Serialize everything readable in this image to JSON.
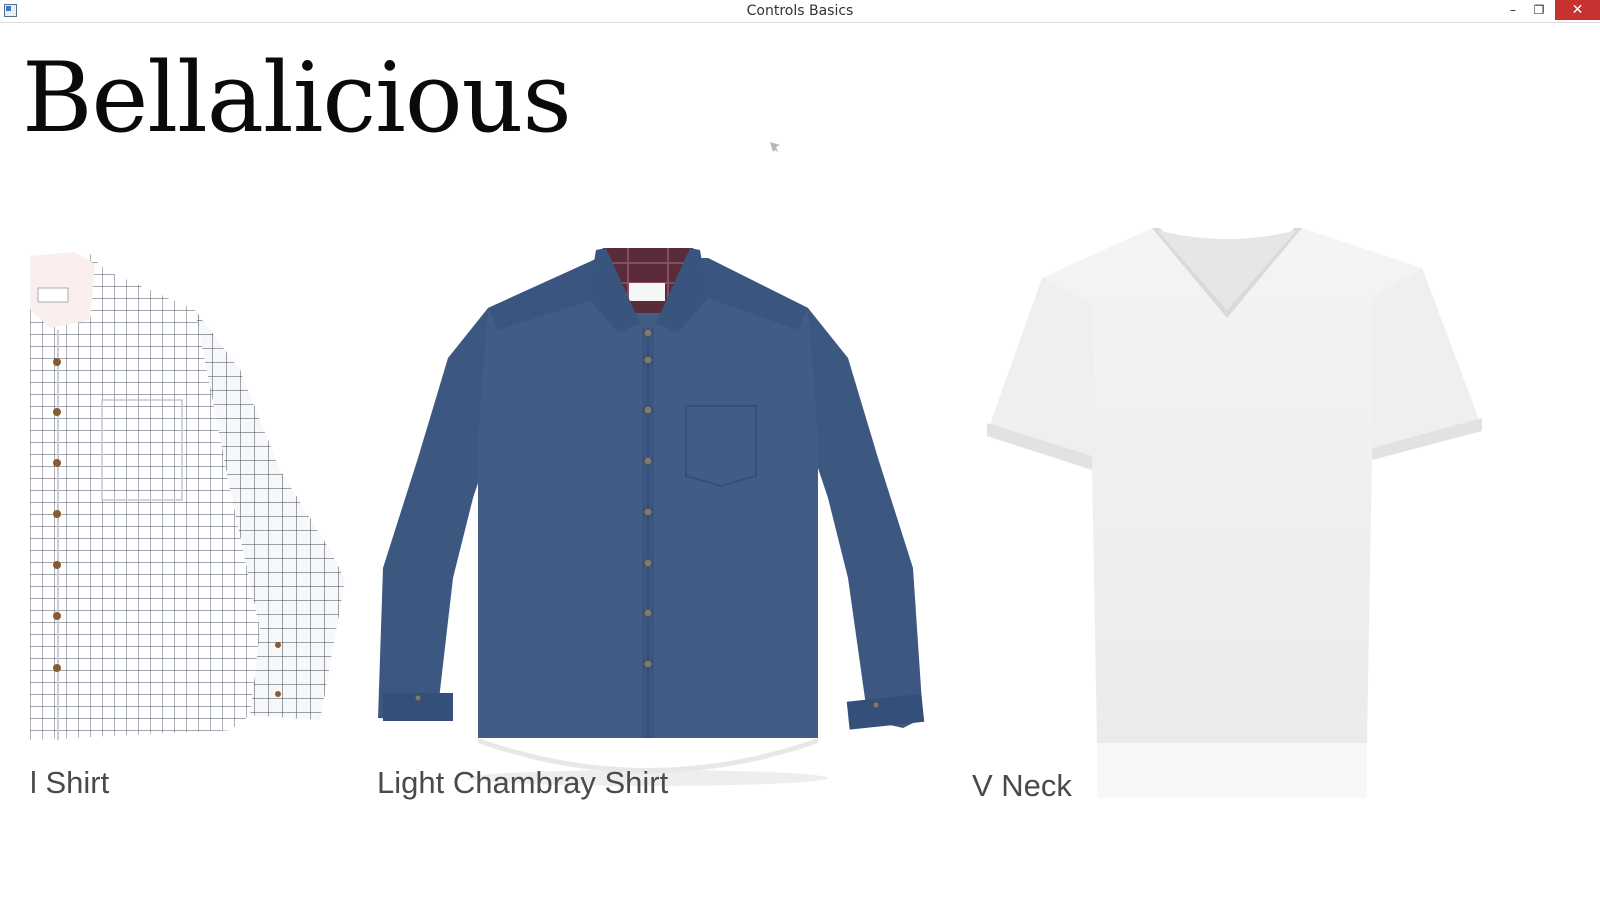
{
  "window": {
    "title": "Controls Basics",
    "minimize": "–",
    "restore": "❐",
    "close": "✕"
  },
  "header": {
    "brand": "Bellalicious"
  },
  "products": [
    {
      "name": "l Shirt",
      "image_icon": "plaid-shirt-image"
    },
    {
      "name": "Light Chambray Shirt",
      "image_icon": "chambray-shirt-image"
    },
    {
      "name": "V Neck",
      "image_icon": "white-vneck-tshirt-image"
    }
  ],
  "colors": {
    "close_button": "#c7312f",
    "chambray": "#3f5b84",
    "label_text": "#4a4a4a"
  }
}
